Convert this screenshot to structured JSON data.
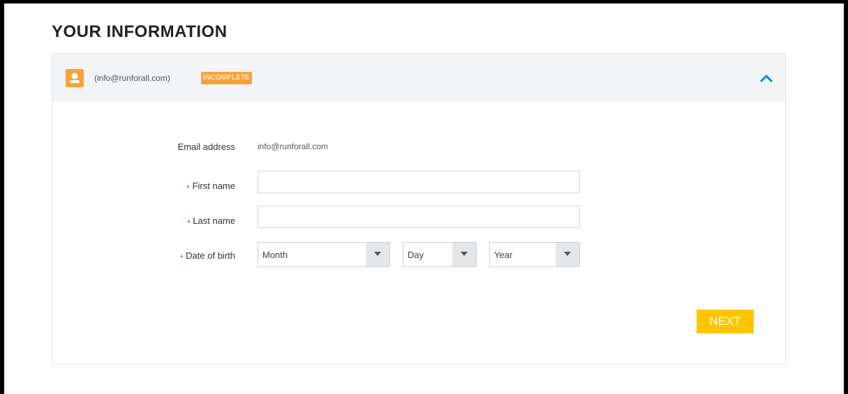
{
  "page": {
    "title": "YOUR INFORMATION"
  },
  "header": {
    "email_display": "(info@runforall.com)",
    "status_badge": "INCOMPLETE",
    "avatar_icon": "user-icon",
    "toggle_icon": "chevron-up-icon",
    "badge_color": "#f5a339",
    "toggle_color": "#1a8fd6"
  },
  "form": {
    "email": {
      "label": "Email address",
      "value": "info@runforall.com"
    },
    "first_name": {
      "required_mark": "•",
      "label": "First name",
      "value": ""
    },
    "last_name": {
      "required_mark": "•",
      "label": "Last name",
      "value": ""
    },
    "dob": {
      "required_mark": "•",
      "label": "Date of birth",
      "month": "Month",
      "day": "Day",
      "year": "Year"
    },
    "next_label": "NEXT",
    "next_color": "#ffc600"
  }
}
